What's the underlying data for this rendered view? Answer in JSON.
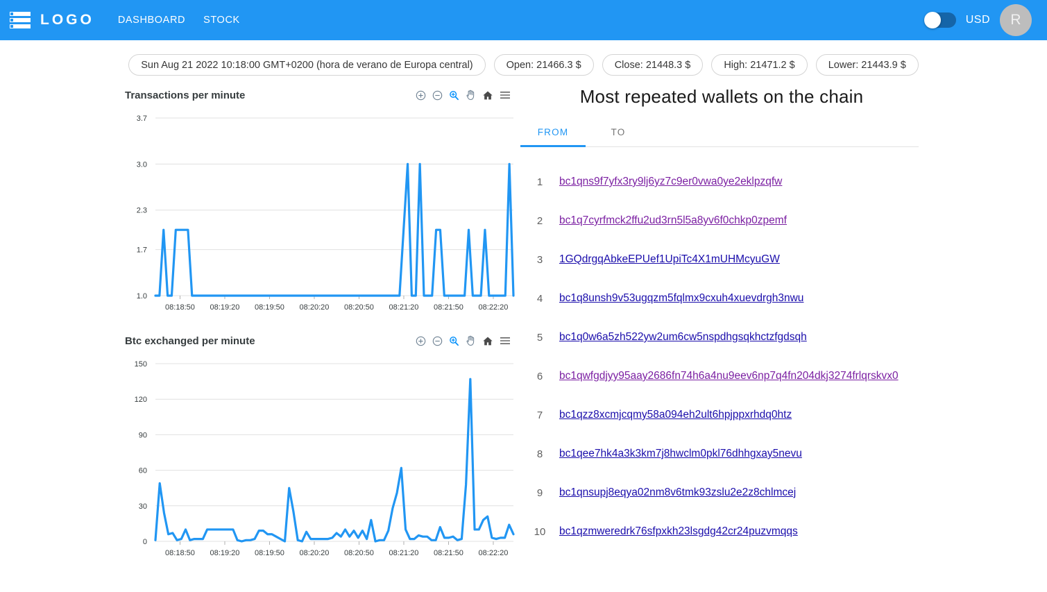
{
  "header": {
    "menu_icon": "list-menu-icon",
    "brand": "LOGO",
    "nav": [
      {
        "label": "DASHBOARD",
        "name": "dashboard"
      },
      {
        "label": "STOCK",
        "name": "stock"
      }
    ],
    "toggle": {
      "name": "currency-toggle",
      "state": "off"
    },
    "currency": "USD",
    "avatar_initial": "R",
    "bg_color": "#2196f3"
  },
  "stats": [
    {
      "name": "timestamp",
      "label": "Sun Aug 21 2022 10:18:00 GMT+0200 (hora de verano de Europa central)"
    },
    {
      "name": "open",
      "label": "Open: 21466.3 $"
    },
    {
      "name": "close",
      "label": "Close: 21448.3 $"
    },
    {
      "name": "high",
      "label": "High: 21471.2 $"
    },
    {
      "name": "lower",
      "label": "Lower: 21443.9 $"
    }
  ],
  "chart_toolbar": [
    {
      "name": "zoom-in-icon",
      "label": "Zoom In",
      "active": false
    },
    {
      "name": "zoom-out-icon",
      "label": "Zoom Out",
      "active": false
    },
    {
      "name": "selection-zoom-icon",
      "label": "Selection Zoom",
      "active": true
    },
    {
      "name": "pan-hand-icon",
      "label": "Panning",
      "active": false
    },
    {
      "name": "home-reset-icon",
      "label": "Reset Zoom",
      "active": false
    },
    {
      "name": "hamburger-menu-icon",
      "label": "Menu",
      "active": false
    }
  ],
  "charts": {
    "transactions_title": "Transactions per minute",
    "btc_title": "Btc exchanged per minute"
  },
  "chart_data": [
    {
      "type": "line",
      "name": "transactions-per-minute",
      "title": "Transactions per minute",
      "xlabel": "",
      "ylabel": "",
      "grid": true,
      "legend": "none",
      "line_color": "#2196f3",
      "yticks": [
        "3.7",
        "3.0",
        "2.3",
        "1.7",
        "1.0"
      ],
      "ytick_values": [
        3.7,
        3.0,
        2.3,
        1.7,
        1.0
      ],
      "ylim": [
        1.0,
        3.7
      ],
      "xticks": [
        "08:18:50",
        "08:19:20",
        "08:19:50",
        "08:20:20",
        "08:20:50",
        "08:21:20",
        "08:21:50",
        "08:22:20"
      ],
      "values": [
        1,
        1,
        2,
        1,
        1,
        2,
        2,
        2,
        2,
        1,
        1,
        1,
        1,
        1,
        1,
        1,
        1,
        1,
        1,
        1,
        1,
        1,
        1,
        1,
        1,
        1,
        1,
        1,
        1,
        1,
        1,
        1,
        1,
        1,
        1,
        1,
        1,
        1,
        1,
        1,
        1,
        1,
        1,
        1,
        1,
        1,
        1,
        1,
        1,
        1,
        1,
        1,
        1,
        1,
        1,
        1,
        1,
        1,
        1,
        1,
        1,
        2,
        3,
        1,
        1,
        3,
        1,
        1,
        1,
        2,
        2,
        1,
        1,
        1,
        1,
        1,
        1,
        2,
        1,
        1,
        1,
        2,
        1,
        1,
        1,
        1,
        1,
        3,
        1
      ]
    },
    {
      "type": "line",
      "name": "btc-exchanged-per-minute",
      "title": "Btc exchanged per minute",
      "xlabel": "",
      "ylabel": "",
      "grid": true,
      "legend": "none",
      "line_color": "#2196f3",
      "yticks": [
        "150",
        "120",
        "90",
        "60",
        "30",
        "0"
      ],
      "ytick_values": [
        150,
        120,
        90,
        60,
        30,
        0
      ],
      "ylim": [
        0,
        150
      ],
      "xticks": [
        "08:18:50",
        "08:19:20",
        "08:19:50",
        "08:20:20",
        "08:20:50",
        "08:21:20",
        "08:21:50",
        "08:22:20"
      ],
      "values": [
        1,
        49,
        24,
        6,
        7,
        1,
        2,
        10,
        1,
        2,
        2,
        2,
        10,
        10,
        10,
        10,
        10,
        10,
        10,
        1,
        0,
        1,
        1,
        2,
        9,
        9,
        6,
        6,
        4,
        2,
        0,
        45,
        25,
        1,
        0,
        8,
        2,
        2,
        2,
        2,
        2,
        3,
        7,
        4,
        10,
        4,
        9,
        3,
        9,
        2,
        18,
        0,
        1,
        1,
        9,
        28,
        41,
        62,
        10,
        2,
        2,
        5,
        4,
        4,
        1,
        1,
        12,
        3,
        3,
        4,
        1,
        2,
        48,
        137,
        10,
        10,
        18,
        21,
        3,
        2,
        3,
        3,
        14,
        6
      ]
    }
  ],
  "panel": {
    "title": "Most repeated wallets on the chain",
    "tabs": [
      {
        "label": "FROM",
        "name": "from",
        "active": true
      },
      {
        "label": "TO",
        "name": "to",
        "active": false
      }
    ],
    "wallets": [
      {
        "index": "1",
        "address": "bc1qns9f7yfx3ry9lj6yz7c9er0vwa0ye2eklpzqfw",
        "visited": true
      },
      {
        "index": "2",
        "address": "bc1q7cyrfmck2ffu2ud3rn5l5a8yv6f0chkp0zpemf",
        "visited": true
      },
      {
        "index": "3",
        "address": "1GQdrgqAbkeEPUef1UpiTc4X1mUHMcyuGW",
        "visited": false
      },
      {
        "index": "4",
        "address": "bc1q8unsh9v53ugqzm5fqlmx9cxuh4xuevdrgh3nwu",
        "visited": false
      },
      {
        "index": "5",
        "address": "bc1q0w6a5zh522yw2um6cw5nspdhgsqkhctzfgdsqh",
        "visited": false
      },
      {
        "index": "6",
        "address": "bc1qwfgdjyy95aay2686fn74h6a4nu9eev6np7q4fn204dkj3274frlqrskvx0",
        "visited": true
      },
      {
        "index": "7",
        "address": "bc1qzz8xcmjcqmy58a094eh2ult6hpjppxrhdq0htz",
        "visited": false
      },
      {
        "index": "8",
        "address": "bc1qee7hk4a3k3km7j8hwclm0pkl76dhhgxay5nevu",
        "visited": false
      },
      {
        "index": "9",
        "address": "bc1qnsupj8eqya02nm8v6tmk93zslu2e2z8chlmcej",
        "visited": false
      },
      {
        "index": "10",
        "address": "bc1qzmweredrk76sfpxkh23lsgdg42cr24puzvmqqs",
        "visited": false
      }
    ]
  },
  "colors": {
    "accent": "#2196f3",
    "link_unvisited": "#1a0dab",
    "link_visited": "#7b1fa2",
    "grid": "#e0e0e0"
  }
}
